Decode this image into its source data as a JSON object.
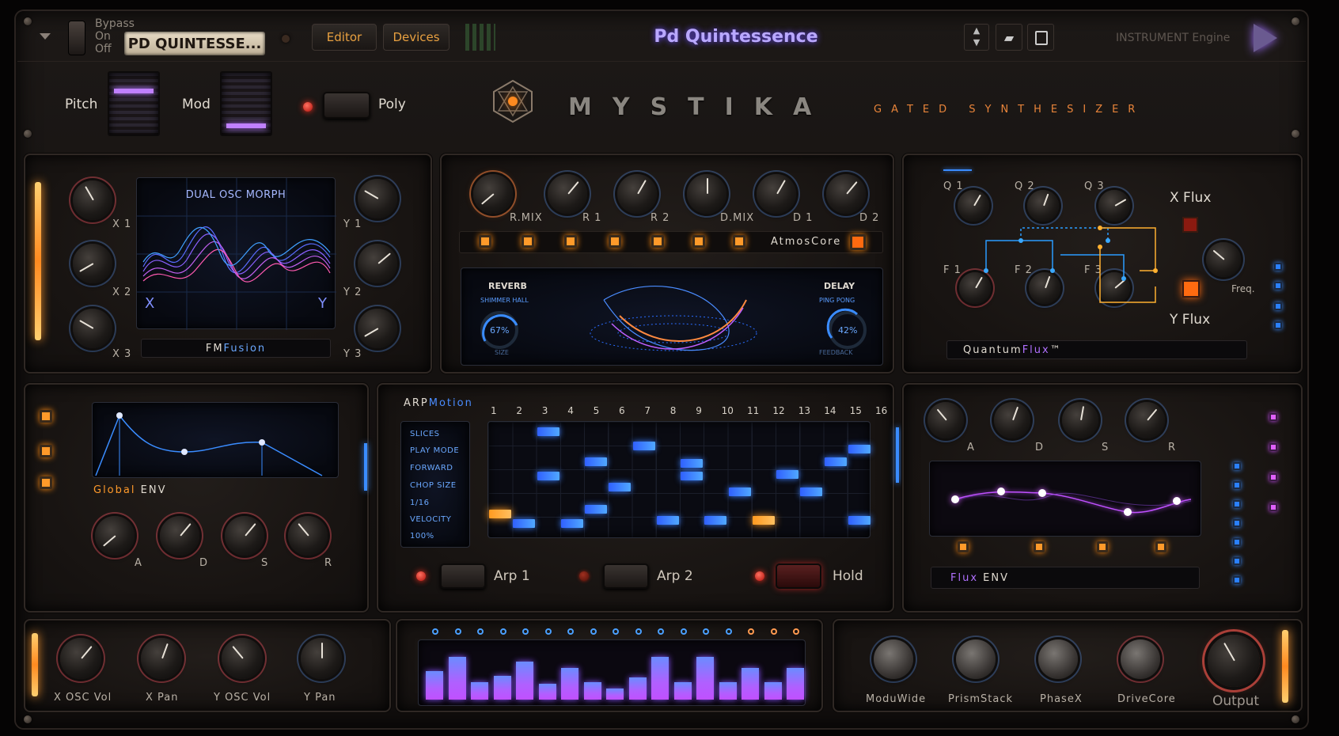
{
  "header": {
    "bypass_label": "Bypass",
    "on_label": "On",
    "off_label": "Off",
    "preset_name": "PD QUINTESSE...",
    "editor_tab": "Editor",
    "devices_tab": "Devices",
    "title": "Pd Quintessence",
    "engine_label": "INSTRUMENT Engine"
  },
  "controls_top": {
    "pitch_label": "Pitch",
    "mod_label": "Mod",
    "poly_label": "Poly"
  },
  "brand": {
    "name": "MYSTIKA",
    "subtitle": "GATED SYNTHESIZER"
  },
  "fm_section": {
    "screen_title": "DUAL OSC MORPH",
    "x_label": "X",
    "y_label": "Y",
    "knobs_left": [
      "X 1",
      "X 2",
      "X 3"
    ],
    "knobs_right": [
      "Y 1",
      "Y 2",
      "Y 3"
    ],
    "footer_a": "FM",
    "footer_b": "Fusion"
  },
  "atmos_section": {
    "knobs": [
      "R.MIX",
      "R 1",
      "R 2",
      "D.MIX",
      "D 1",
      "D 2"
    ],
    "footer": "AtmosCore",
    "reverb_title": "REVERB",
    "reverb_mode": "SHIMMER HALL",
    "reverb_value": "67%",
    "reverb_param": "SIZE",
    "delay_title": "DELAY",
    "delay_mode": "PING PONG",
    "delay_value": "42%",
    "delay_param": "FEEDBACK"
  },
  "quantum_section": {
    "q_labels": [
      "Q 1",
      "Q 2",
      "Q 3"
    ],
    "f_labels": [
      "F 1",
      "F 2",
      "F 3"
    ],
    "x_flux": "X Flux",
    "y_flux": "Y Flux",
    "freq": "Freq.",
    "footer_a": "Quantum",
    "footer_b": "Flux",
    "tm": "™"
  },
  "global_env": {
    "label_a": "Global",
    "label_b": "ENV",
    "knobs": [
      "A",
      "D",
      "S",
      "R"
    ]
  },
  "arp_section": {
    "title_a": "ARP",
    "title_b": "Motion",
    "menu": [
      "SLICES",
      "PLAY MODE",
      "FORWARD",
      "CHOP SIZE",
      "1/16",
      "VELOCITY",
      "100%"
    ],
    "steps": [
      "1",
      "2",
      "3",
      "4",
      "5",
      "6",
      "7",
      "8",
      "9",
      "10",
      "11",
      "12",
      "13",
      "14",
      "15",
      "16"
    ],
    "arp1": "Arp 1",
    "arp2": "Arp 2",
    "hold": "Hold"
  },
  "flux_env": {
    "knobs": [
      "A",
      "D",
      "S",
      "R"
    ],
    "label_a": "Flux",
    "label_b": "ENV"
  },
  "bottom_left": {
    "knobs": [
      "X OSC Vol",
      "X Pan",
      "Y OSC Vol",
      "Y Pan"
    ]
  },
  "bottom_right": {
    "knobs": [
      "ModuWide",
      "PrismStack",
      "PhaseX",
      "DriveCore"
    ],
    "output": "Output"
  },
  "colors": {
    "accent_orange": "#ff9a2a",
    "accent_blue": "#3a7cff",
    "accent_purple": "#c050ff"
  }
}
